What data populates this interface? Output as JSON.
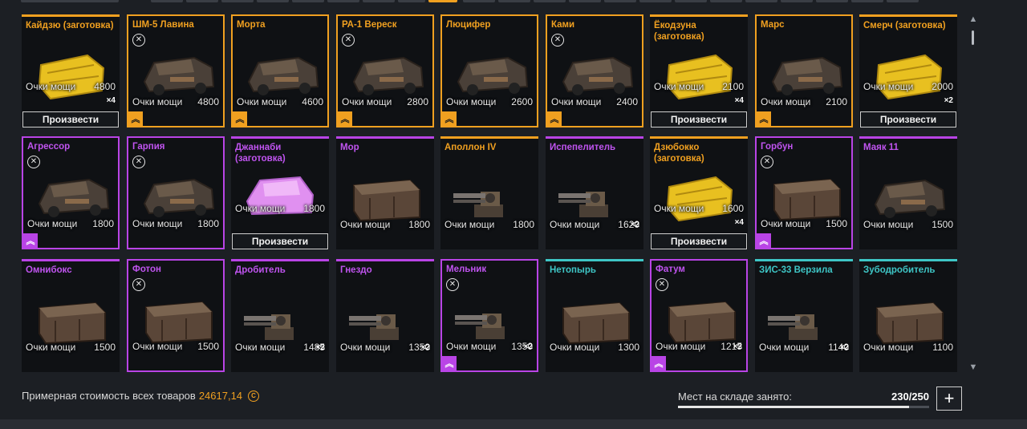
{
  "labels": {
    "power": "Очки мощи",
    "produce": "Произвести"
  },
  "colors": {
    "epic_orange": "#f0a020",
    "special_purple": "#b944e6",
    "rare_teal": "#3ec6c6",
    "ghost_gold": "#e8c020",
    "ghost_violet": "#e090f0"
  },
  "items": [
    {
      "name": "Кайдзю (заготовка)",
      "power": "4800",
      "qty": "×4",
      "produce": true,
      "craft": false,
      "rank": false,
      "rarity": "orange",
      "ghost": "gold"
    },
    {
      "name": "ШМ-5 Лавина",
      "power": "4800",
      "qty": "",
      "produce": false,
      "craft": true,
      "rank": true,
      "rarity": "orange",
      "ghost": ""
    },
    {
      "name": "Морта",
      "power": "4600",
      "qty": "",
      "produce": false,
      "craft": false,
      "rank": true,
      "rarity": "orange",
      "ghost": ""
    },
    {
      "name": "РА-1 Вереск",
      "power": "2800",
      "qty": "",
      "produce": false,
      "craft": true,
      "rank": true,
      "rarity": "orange",
      "ghost": ""
    },
    {
      "name": "Люцифер",
      "power": "2600",
      "qty": "",
      "produce": false,
      "craft": false,
      "rank": true,
      "rarity": "orange",
      "ghost": ""
    },
    {
      "name": "Ками",
      "power": "2400",
      "qty": "",
      "produce": false,
      "craft": true,
      "rank": true,
      "rarity": "orange",
      "ghost": ""
    },
    {
      "name": "Ёкодзуна (заготовка)",
      "power": "2100",
      "qty": "×4",
      "produce": true,
      "craft": false,
      "rank": false,
      "rarity": "orange",
      "ghost": "gold"
    },
    {
      "name": "Марс",
      "power": "2100",
      "qty": "",
      "produce": false,
      "craft": false,
      "rank": true,
      "rarity": "orange",
      "ghost": ""
    },
    {
      "name": "Смерч (заготовка)",
      "power": "2000",
      "qty": "×2",
      "produce": true,
      "craft": false,
      "rank": false,
      "rarity": "orange",
      "ghost": "gold"
    },
    {
      "name": "Агрессор",
      "power": "1800",
      "qty": "",
      "produce": false,
      "craft": true,
      "rank": true,
      "rarity": "purple",
      "ghost": ""
    },
    {
      "name": "Гарпия",
      "power": "1800",
      "qty": "",
      "produce": false,
      "craft": true,
      "rank": false,
      "rarity": "purple",
      "ghost": ""
    },
    {
      "name": "Джаннаби (заготовка)",
      "power": "1800",
      "qty": "×4",
      "produce": true,
      "craft": false,
      "rank": false,
      "rarity": "purple",
      "ghost": "violet"
    },
    {
      "name": "Мор",
      "power": "1800",
      "qty": "",
      "produce": false,
      "craft": false,
      "rank": false,
      "rarity": "purple",
      "ghost": ""
    },
    {
      "name": "Аполлон IV",
      "power": "1800",
      "qty": "",
      "produce": false,
      "craft": false,
      "rank": false,
      "rarity": "orange",
      "ghost": ""
    },
    {
      "name": "Испепелитель",
      "power": "1620",
      "qty": "×2",
      "produce": false,
      "craft": false,
      "rank": false,
      "rarity": "purple",
      "ghost": ""
    },
    {
      "name": "Дзюбокко (заготовка)",
      "power": "1600",
      "qty": "×4",
      "produce": true,
      "craft": false,
      "rank": false,
      "rarity": "orange",
      "ghost": "gold"
    },
    {
      "name": "Горбун",
      "power": "1500",
      "qty": "",
      "produce": false,
      "craft": true,
      "rank": true,
      "rarity": "purple",
      "ghost": ""
    },
    {
      "name": "Маяк 11",
      "power": "1500",
      "qty": "",
      "produce": false,
      "craft": false,
      "rank": false,
      "rarity": "purple",
      "ghost": ""
    },
    {
      "name": "Омнибокс",
      "power": "1500",
      "qty": "",
      "produce": false,
      "craft": false,
      "rank": false,
      "rarity": "purple",
      "ghost": ""
    },
    {
      "name": "Фотон",
      "power": "1500",
      "qty": "",
      "produce": false,
      "craft": true,
      "rank": false,
      "rarity": "purple",
      "ghost": ""
    },
    {
      "name": "Дробитель",
      "power": "1485",
      "qty": "×2",
      "produce": false,
      "craft": false,
      "rank": false,
      "rarity": "purple",
      "ghost": ""
    },
    {
      "name": "Гнездо",
      "power": "1350",
      "qty": "×2",
      "produce": false,
      "craft": false,
      "rank": false,
      "rarity": "purple",
      "ghost": ""
    },
    {
      "name": "Мельник",
      "power": "1350",
      "qty": "×2",
      "produce": false,
      "craft": true,
      "rank": true,
      "rarity": "purple",
      "ghost": ""
    },
    {
      "name": "Нетопырь",
      "power": "1300",
      "qty": "",
      "produce": false,
      "craft": false,
      "rank": false,
      "rarity": "teal",
      "ghost": ""
    },
    {
      "name": "Фатум",
      "power": "1215",
      "qty": "×2",
      "produce": false,
      "craft": true,
      "rank": true,
      "rarity": "purple",
      "ghost": ""
    },
    {
      "name": "ЗИС-33 Верзила",
      "power": "1140",
      "qty": "×2",
      "produce": false,
      "craft": false,
      "rank": false,
      "rarity": "teal",
      "ghost": ""
    },
    {
      "name": "Зубодробитель",
      "power": "1100",
      "qty": "",
      "produce": false,
      "craft": false,
      "rank": false,
      "rarity": "teal",
      "ghost": ""
    }
  ],
  "footer": {
    "total_label": "Примерная стоимость всех товаров",
    "total_value": "24617,14",
    "coin_icon": "C",
    "storage_label": "Мест на складе занято:",
    "storage_value": "230/250",
    "storage_fraction": 0.92,
    "add_label": "+"
  },
  "scroll": {
    "up": "▲",
    "down": "▼"
  }
}
